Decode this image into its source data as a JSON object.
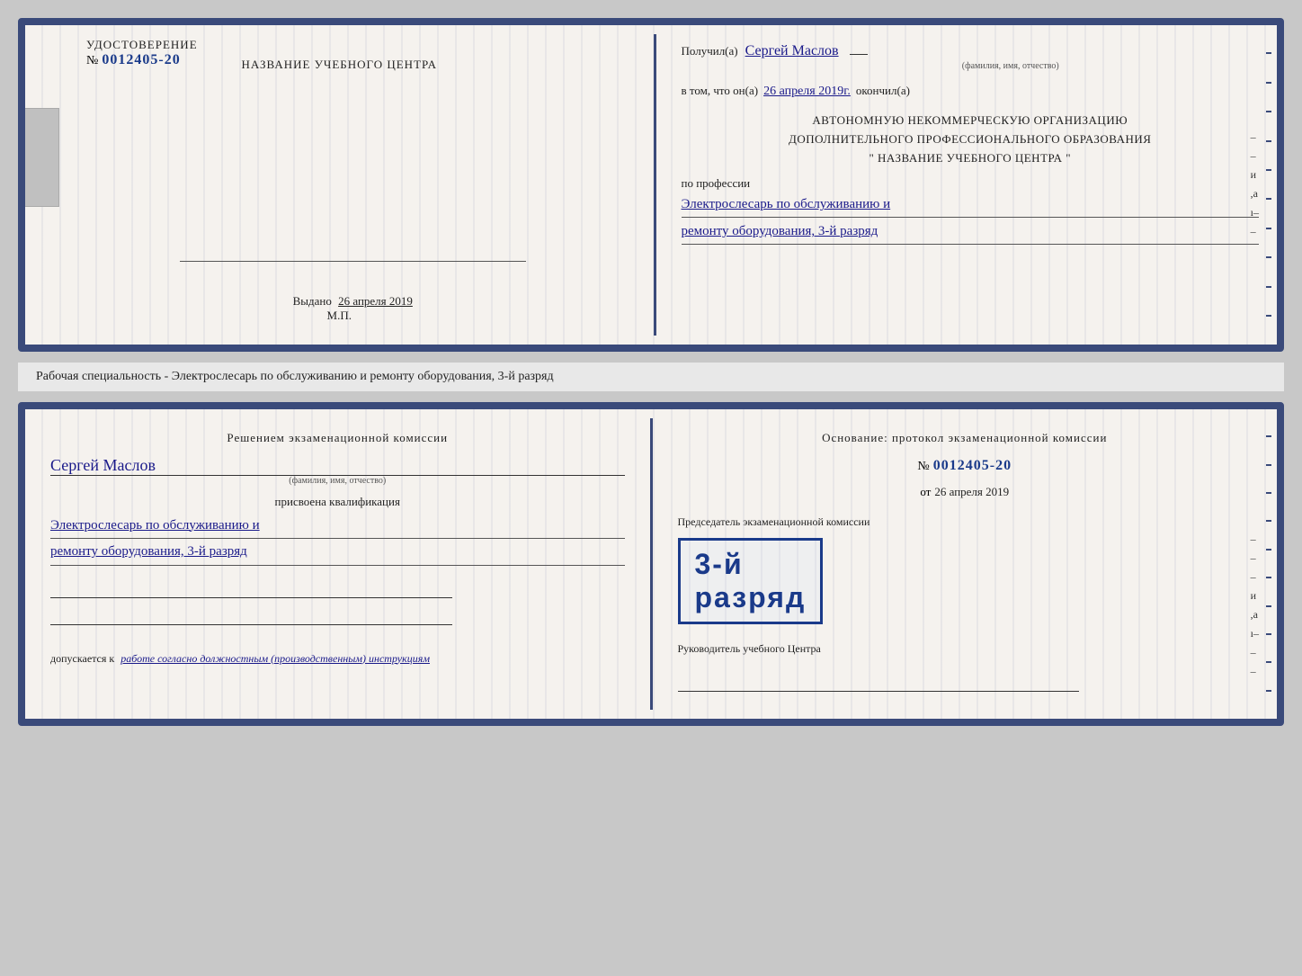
{
  "page": {
    "background": "#c8c8c8"
  },
  "cert1": {
    "left": {
      "title": "НАЗВАНИЕ УЧЕБНОГО ЦЕНТРА",
      "udost_label": "УДОСТОВЕРЕНИЕ",
      "number_prefix": "№",
      "number": "0012405-20",
      "vydano_label": "Выдано",
      "vydano_date": "26 апреля 2019",
      "mp_label": "М.П."
    },
    "right": {
      "poluchil_label": "Получил(а)",
      "fio": "Сергей Маслов",
      "fio_note": "(фамилия, имя, отчество)",
      "vtom_label": "в том, что он(а)",
      "date": "26 апреля 2019г.",
      "okonchil_label": "окончил(а)",
      "org_line1": "АВТОНОМНУЮ НЕКОММЕРЧЕСКУЮ ОРГАНИЗАЦИЮ",
      "org_line2": "ДОПОЛНИТЕЛЬНОГО ПРОФЕССИОНАЛЬНОГО ОБРАЗОВАНИЯ",
      "org_name": "\"   НАЗВАНИЕ УЧЕБНОГО ЦЕНТРА   \"",
      "poprofessii_label": "по профессии",
      "profession_line1": "Электрослесарь по обслуживанию и",
      "profession_line2": "ремонту оборудования, 3-й разряд"
    }
  },
  "middle": {
    "text": "Рабочая специальность - Электрослесарь по обслуживанию и ремонту оборудования, 3-й разряд"
  },
  "cert2": {
    "left": {
      "resheniem_label": "Решением  экзаменационной  комиссии",
      "fio": "Сергей Маслов",
      "fio_note": "(фамилия, имя, отчество)",
      "prisvoena_label": "присвоена квалификация",
      "kvali_line1": "Электрослесарь по обслуживанию и",
      "kvali_line2": "ремонту оборудования, 3-й разряд",
      "dopusk_label": "допускается к",
      "dopusk_text": "работе согласно должностным (производственным) инструкциям"
    },
    "right": {
      "osnovanie_label": "Основание: протокол экзаменационной  комиссии",
      "number_prefix": "№",
      "number": "0012405-20",
      "ot_prefix": "от",
      "ot_date": "26 апреля 2019",
      "predsedatel_label": "Председатель экзаменационной комиссии",
      "stamp_line1": "3-й",
      "stamp_line2": "разряд",
      "rukovoditel_label": "Руководитель учебного Центра"
    }
  }
}
